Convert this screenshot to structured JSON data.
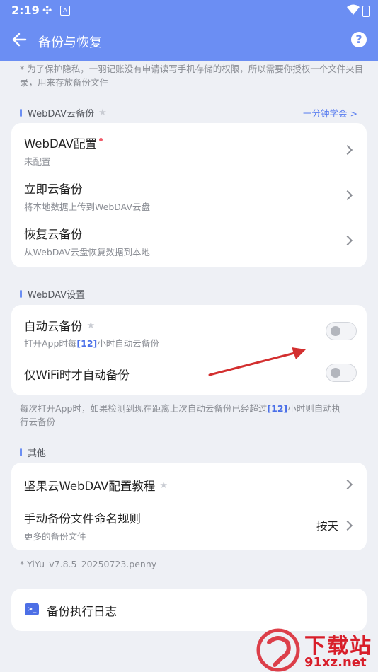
{
  "status_bar": {
    "time": "2:19"
  },
  "app_bar": {
    "title": "备份与恢复",
    "help_label": "?"
  },
  "privacy_note": "* 为了保护隐私，一羽记账没有申请读写手机存储的权限，所以需要你授权一个文件夹目录，用来存放备份文件",
  "webdav_backup": {
    "section_title": "WebDAV云备份",
    "learn_link": "一分钟学会 >",
    "items": [
      {
        "title": "WebDAV配置",
        "subtitle": "未配置"
      },
      {
        "title": "立即云备份",
        "subtitle": "将本地数据上传到WebDAV云盘"
      },
      {
        "title": "恢复云备份",
        "subtitle": "从WebDAV云盘恢复数据到本地"
      }
    ]
  },
  "webdav_settings": {
    "section_title": "WebDAV设置",
    "auto_backup": {
      "title": "自动云备份",
      "subtitle_pre": "打开App时每",
      "subtitle_num": "[12]",
      "subtitle_post": "小时自动云备份",
      "enabled": false
    },
    "wifi_only": {
      "title": "仅WiFi时才自动备份",
      "enabled": false
    },
    "note_line1_pre": "每次打开App时，如果检测到现在距离上次自动云备份已经超过",
    "note_num": "[12]",
    "note_line1_post": "小时则自动执",
    "note_line2": "行云备份"
  },
  "other": {
    "section_title": "其他",
    "items": [
      {
        "title": "坚果云WebDAV配置教程"
      },
      {
        "title": "手动备份文件命名规则",
        "subtitle": "更多的备份文件",
        "value": "按天"
      }
    ]
  },
  "version": "* YiYu_v7.8.5_20250723.penny",
  "log_item": {
    "title": "备份执行日志",
    "icon_glyph": ">_"
  },
  "watermark": {
    "text_top": "下载站",
    "text_bottom": "91xz.net",
    "brand_color": "#d81e2a"
  },
  "colors": {
    "accent": "#6b8ef3",
    "arrow": "#d32f2f",
    "badge_dot": "#f05b6a"
  }
}
